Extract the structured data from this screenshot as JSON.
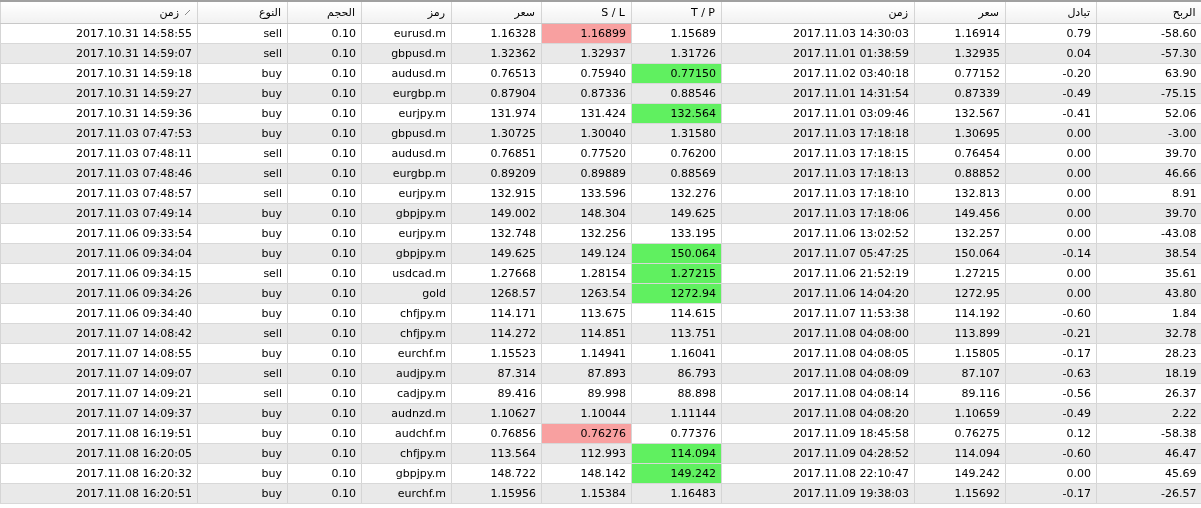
{
  "columns": [
    {
      "label": "الربح",
      "sorted": false
    },
    {
      "label": "تبادل",
      "sorted": false
    },
    {
      "label": "سعر",
      "sorted": false
    },
    {
      "label": "زمن",
      "sorted": false
    },
    {
      "label": "T / P",
      "sorted": false
    },
    {
      "label": "S / L",
      "sorted": false
    },
    {
      "label": "سعر",
      "sorted": false
    },
    {
      "label": "رمز",
      "sorted": false
    },
    {
      "label": "الحجم",
      "sorted": false
    },
    {
      "label": "النوع",
      "sorted": false
    },
    {
      "label": "زمن",
      "sorted": true
    }
  ],
  "rows": [
    {
      "open_time": "2017.10.31 14:58:55",
      "type": "sell",
      "volume": "0.10",
      "symbol": "eurusd.m",
      "open_price": "1.16328",
      "sl": "1.16899",
      "tp": "1.15689",
      "close_time": "2017.11.03 14:30:03",
      "close_price": "1.16914",
      "swap": "0.79",
      "profit": "-58.60",
      "sl_hit": true,
      "tp_hit": false
    },
    {
      "open_time": "2017.10.31 14:59:07",
      "type": "sell",
      "volume": "0.10",
      "symbol": "gbpusd.m",
      "open_price": "1.32362",
      "sl": "1.32937",
      "tp": "1.31726",
      "close_time": "2017.11.01 01:38:59",
      "close_price": "1.32935",
      "swap": "0.04",
      "profit": "-57.30",
      "sl_hit": false,
      "tp_hit": false
    },
    {
      "open_time": "2017.10.31 14:59:18",
      "type": "buy",
      "volume": "0.10",
      "symbol": "audusd.m",
      "open_price": "0.76513",
      "sl": "0.75940",
      "tp": "0.77150",
      "close_time": "2017.11.02 03:40:18",
      "close_price": "0.77152",
      "swap": "-0.20",
      "profit": "63.90",
      "sl_hit": false,
      "tp_hit": true
    },
    {
      "open_time": "2017.10.31 14:59:27",
      "type": "buy",
      "volume": "0.10",
      "symbol": "eurgbp.m",
      "open_price": "0.87904",
      "sl": "0.87336",
      "tp": "0.88546",
      "close_time": "2017.11.01 14:31:54",
      "close_price": "0.87339",
      "swap": "-0.49",
      "profit": "-75.15",
      "sl_hit": false,
      "tp_hit": false
    },
    {
      "open_time": "2017.10.31 14:59:36",
      "type": "buy",
      "volume": "0.10",
      "symbol": "eurjpy.m",
      "open_price": "131.974",
      "sl": "131.424",
      "tp": "132.564",
      "close_time": "2017.11.01 03:09:46",
      "close_price": "132.567",
      "swap": "-0.41",
      "profit": "52.06",
      "sl_hit": false,
      "tp_hit": true
    },
    {
      "open_time": "2017.11.03 07:47:53",
      "type": "buy",
      "volume": "0.10",
      "symbol": "gbpusd.m",
      "open_price": "1.30725",
      "sl": "1.30040",
      "tp": "1.31580",
      "close_time": "2017.11.03 17:18:18",
      "close_price": "1.30695",
      "swap": "0.00",
      "profit": "-3.00",
      "sl_hit": false,
      "tp_hit": false
    },
    {
      "open_time": "2017.11.03 07:48:11",
      "type": "sell",
      "volume": "0.10",
      "symbol": "audusd.m",
      "open_price": "0.76851",
      "sl": "0.77520",
      "tp": "0.76200",
      "close_time": "2017.11.03 17:18:15",
      "close_price": "0.76454",
      "swap": "0.00",
      "profit": "39.70",
      "sl_hit": false,
      "tp_hit": false
    },
    {
      "open_time": "2017.11.03 07:48:46",
      "type": "sell",
      "volume": "0.10",
      "symbol": "eurgbp.m",
      "open_price": "0.89209",
      "sl": "0.89889",
      "tp": "0.88569",
      "close_time": "2017.11.03 17:18:13",
      "close_price": "0.88852",
      "swap": "0.00",
      "profit": "46.66",
      "sl_hit": false,
      "tp_hit": false
    },
    {
      "open_time": "2017.11.03 07:48:57",
      "type": "sell",
      "volume": "0.10",
      "symbol": "eurjpy.m",
      "open_price": "132.915",
      "sl": "133.596",
      "tp": "132.276",
      "close_time": "2017.11.03 17:18:10",
      "close_price": "132.813",
      "swap": "0.00",
      "profit": "8.91",
      "sl_hit": false,
      "tp_hit": false
    },
    {
      "open_time": "2017.11.03 07:49:14",
      "type": "buy",
      "volume": "0.10",
      "symbol": "gbpjpy.m",
      "open_price": "149.002",
      "sl": "148.304",
      "tp": "149.625",
      "close_time": "2017.11.03 17:18:06",
      "close_price": "149.456",
      "swap": "0.00",
      "profit": "39.70",
      "sl_hit": false,
      "tp_hit": false
    },
    {
      "open_time": "2017.11.06 09:33:54",
      "type": "buy",
      "volume": "0.10",
      "symbol": "eurjpy.m",
      "open_price": "132.748",
      "sl": "132.256",
      "tp": "133.195",
      "close_time": "2017.11.06 13:02:52",
      "close_price": "132.257",
      "swap": "0.00",
      "profit": "-43.08",
      "sl_hit": false,
      "tp_hit": false
    },
    {
      "open_time": "2017.11.06 09:34:04",
      "type": "buy",
      "volume": "0.10",
      "symbol": "gbpjpy.m",
      "open_price": "149.625",
      "sl": "149.124",
      "tp": "150.064",
      "close_time": "2017.11.07 05:47:25",
      "close_price": "150.064",
      "swap": "-0.14",
      "profit": "38.54",
      "sl_hit": false,
      "tp_hit": true
    },
    {
      "open_time": "2017.11.06 09:34:15",
      "type": "sell",
      "volume": "0.10",
      "symbol": "usdcad.m",
      "open_price": "1.27668",
      "sl": "1.28154",
      "tp": "1.27215",
      "close_time": "2017.11.06 21:52:19",
      "close_price": "1.27215",
      "swap": "0.00",
      "profit": "35.61",
      "sl_hit": false,
      "tp_hit": true
    },
    {
      "open_time": "2017.11.06 09:34:26",
      "type": "buy",
      "volume": "0.10",
      "symbol": "gold",
      "open_price": "1268.57",
      "sl": "1263.54",
      "tp": "1272.94",
      "close_time": "2017.11.06 14:04:20",
      "close_price": "1272.95",
      "swap": "0.00",
      "profit": "43.80",
      "sl_hit": false,
      "tp_hit": true
    },
    {
      "open_time": "2017.11.06 09:34:40",
      "type": "buy",
      "volume": "0.10",
      "symbol": "chfjpy.m",
      "open_price": "114.171",
      "sl": "113.675",
      "tp": "114.615",
      "close_time": "2017.11.07 11:53:38",
      "close_price": "114.192",
      "swap": "-0.60",
      "profit": "1.84",
      "sl_hit": false,
      "tp_hit": false
    },
    {
      "open_time": "2017.11.07 14:08:42",
      "type": "sell",
      "volume": "0.10",
      "symbol": "chfjpy.m",
      "open_price": "114.272",
      "sl": "114.851",
      "tp": "113.751",
      "close_time": "2017.11.08 04:08:00",
      "close_price": "113.899",
      "swap": "-0.21",
      "profit": "32.78",
      "sl_hit": false,
      "tp_hit": false
    },
    {
      "open_time": "2017.11.07 14:08:55",
      "type": "buy",
      "volume": "0.10",
      "symbol": "eurchf.m",
      "open_price": "1.15523",
      "sl": "1.14941",
      "tp": "1.16041",
      "close_time": "2017.11.08 04:08:05",
      "close_price": "1.15805",
      "swap": "-0.17",
      "profit": "28.23",
      "sl_hit": false,
      "tp_hit": false
    },
    {
      "open_time": "2017.11.07 14:09:07",
      "type": "sell",
      "volume": "0.10",
      "symbol": "audjpy.m",
      "open_price": "87.314",
      "sl": "87.893",
      "tp": "86.793",
      "close_time": "2017.11.08 04:08:09",
      "close_price": "87.107",
      "swap": "-0.63",
      "profit": "18.19",
      "sl_hit": false,
      "tp_hit": false
    },
    {
      "open_time": "2017.11.07 14:09:21",
      "type": "sell",
      "volume": "0.10",
      "symbol": "cadjpy.m",
      "open_price": "89.416",
      "sl": "89.998",
      "tp": "88.898",
      "close_time": "2017.11.08 04:08:14",
      "close_price": "89.116",
      "swap": "-0.56",
      "profit": "26.37",
      "sl_hit": false,
      "tp_hit": false
    },
    {
      "open_time": "2017.11.07 14:09:37",
      "type": "buy",
      "volume": "0.10",
      "symbol": "audnzd.m",
      "open_price": "1.10627",
      "sl": "1.10044",
      "tp": "1.11144",
      "close_time": "2017.11.08 04:08:20",
      "close_price": "1.10659",
      "swap": "-0.49",
      "profit": "2.22",
      "sl_hit": false,
      "tp_hit": false
    },
    {
      "open_time": "2017.11.08 16:19:51",
      "type": "buy",
      "volume": "0.10",
      "symbol": "audchf.m",
      "open_price": "0.76856",
      "sl": "0.76276",
      "tp": "0.77376",
      "close_time": "2017.11.09 18:45:58",
      "close_price": "0.76275",
      "swap": "0.12",
      "profit": "-58.38",
      "sl_hit": true,
      "tp_hit": false
    },
    {
      "open_time": "2017.11.08 16:20:05",
      "type": "buy",
      "volume": "0.10",
      "symbol": "chfjpy.m",
      "open_price": "113.564",
      "sl": "112.993",
      "tp": "114.094",
      "close_time": "2017.11.09 04:28:52",
      "close_price": "114.094",
      "swap": "-0.60",
      "profit": "46.47",
      "sl_hit": false,
      "tp_hit": true
    },
    {
      "open_time": "2017.11.08 16:20:32",
      "type": "buy",
      "volume": "0.10",
      "symbol": "gbpjpy.m",
      "open_price": "148.722",
      "sl": "148.142",
      "tp": "149.242",
      "close_time": "2017.11.08 22:10:47",
      "close_price": "149.242",
      "swap": "0.00",
      "profit": "45.69",
      "sl_hit": false,
      "tp_hit": true
    },
    {
      "open_time": "2017.11.08 16:20:51",
      "type": "buy",
      "volume": "0.10",
      "symbol": "eurchf.m",
      "open_price": "1.15956",
      "sl": "1.15384",
      "tp": "1.16483",
      "close_time": "2017.11.09 19:38:03",
      "close_price": "1.15692",
      "swap": "-0.17",
      "profit": "-26.57",
      "sl_hit": false,
      "tp_hit": false
    }
  ]
}
